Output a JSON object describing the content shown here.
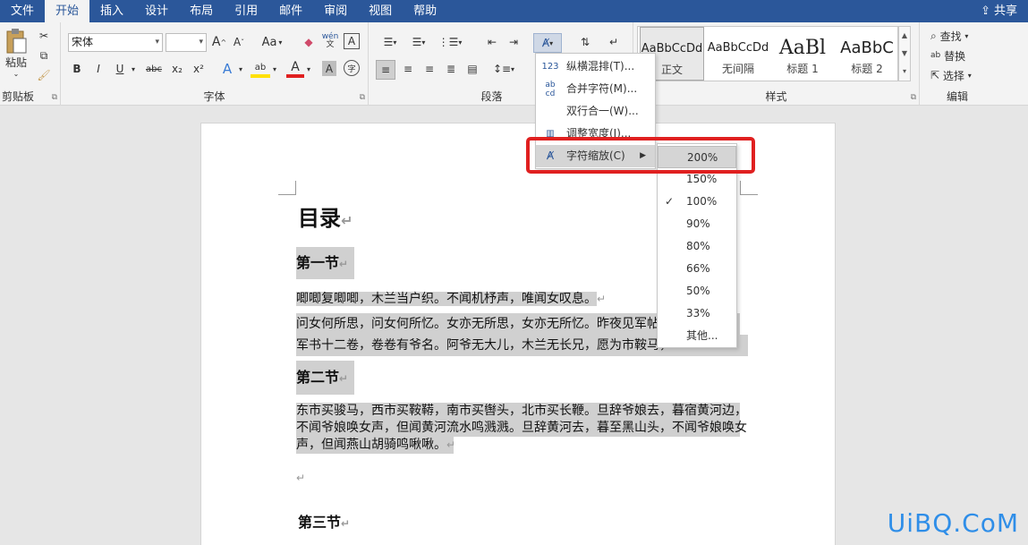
{
  "menubar": {
    "tabs": [
      {
        "label": "文件"
      },
      {
        "label": "开始"
      },
      {
        "label": "插入"
      },
      {
        "label": "设计"
      },
      {
        "label": "布局"
      },
      {
        "label": "引用"
      },
      {
        "label": "邮件"
      },
      {
        "label": "审阅"
      },
      {
        "label": "视图"
      },
      {
        "label": "帮助"
      }
    ],
    "active_tab": "开始",
    "share_label": "共享"
  },
  "ribbon": {
    "clipboard": {
      "label": "剪贴板",
      "paste_label": "粘贴"
    },
    "font": {
      "label": "字体",
      "font_name": "宋体",
      "font_size": "",
      "grow_label": "A",
      "shrink_label": "A",
      "case_label": "Aa",
      "phonetic_label": "wén",
      "border_label": "A",
      "bold": "B",
      "italic": "I",
      "underline": "U",
      "strike": "abc",
      "subscript": "x₂",
      "superscript": "x²",
      "effects": "A",
      "highlight": "ab",
      "font_color": "A",
      "shade": "A",
      "enclose": "字"
    },
    "paragraph": {
      "label": "段落"
    },
    "styles": {
      "label": "样式",
      "items": [
        {
          "preview": "AaBbCcDd",
          "name": "正文"
        },
        {
          "preview": "AaBbCcDd",
          "name": "无间隔"
        },
        {
          "preview": "AaBl",
          "name": "标题 1"
        },
        {
          "preview": "AaBbC",
          "name": "标题 2"
        }
      ]
    },
    "editing": {
      "label": "编辑",
      "find": "查找",
      "replace": "替换",
      "select": "选择"
    }
  },
  "document": {
    "title": "目录",
    "sections": [
      {
        "heading": "第一节"
      },
      {
        "heading": "第二节"
      },
      {
        "heading": "第三节"
      }
    ],
    "para1": "唧唧复唧唧，木兰当户织。不闻机杼声，唯闻女叹息。",
    "para2_line1": "问女何所思，问女何所忆。女亦无所思，女亦无所忆。昨夜见军帖，",
    "para2_line2": "军书十二卷，卷卷有爷名。阿爷无大儿，木兰无长兄，愿为市鞍马，",
    "para3_line1": "东市买骏马，西市买鞍鞯，南市买辔头，北市买长鞭。旦辞爷娘去，暮宿黄河边，",
    "para3_line2": "不闻爷娘唤女声，但闻黄河流水鸣溅溅。旦辞黄河去，暮至黑山头，不闻爷娘唤女",
    "para3_line3": "声，但闻燕山胡骑鸣啾啾。",
    "para_mark": "↵"
  },
  "menu": {
    "items": [
      {
        "label": "纵横混排(T)...",
        "icon": "123"
      },
      {
        "label": "合并字符(M)...",
        "icon": "abcd"
      },
      {
        "label": "双行合一(W)...",
        "icon": ""
      },
      {
        "label": "调整宽度(I)...",
        "icon": "width"
      },
      {
        "label": "字符缩放(C)",
        "icon": "scale"
      }
    ]
  },
  "submenu": {
    "items": [
      {
        "label": "200%"
      },
      {
        "label": "150%"
      },
      {
        "label": "100%"
      },
      {
        "label": "90%"
      },
      {
        "label": "80%"
      },
      {
        "label": "66%"
      },
      {
        "label": "50%"
      },
      {
        "label": "33%"
      },
      {
        "label": "其他..."
      }
    ],
    "selected": "100%",
    "hovered": "200%"
  },
  "watermark": "UiBQ.CoM",
  "colors": {
    "ribbon_blue": "#2b579a",
    "highlight_red": "#e02020",
    "selection_gray": "#d0d0d0",
    "watermark_blue": "#2f8ee8"
  }
}
